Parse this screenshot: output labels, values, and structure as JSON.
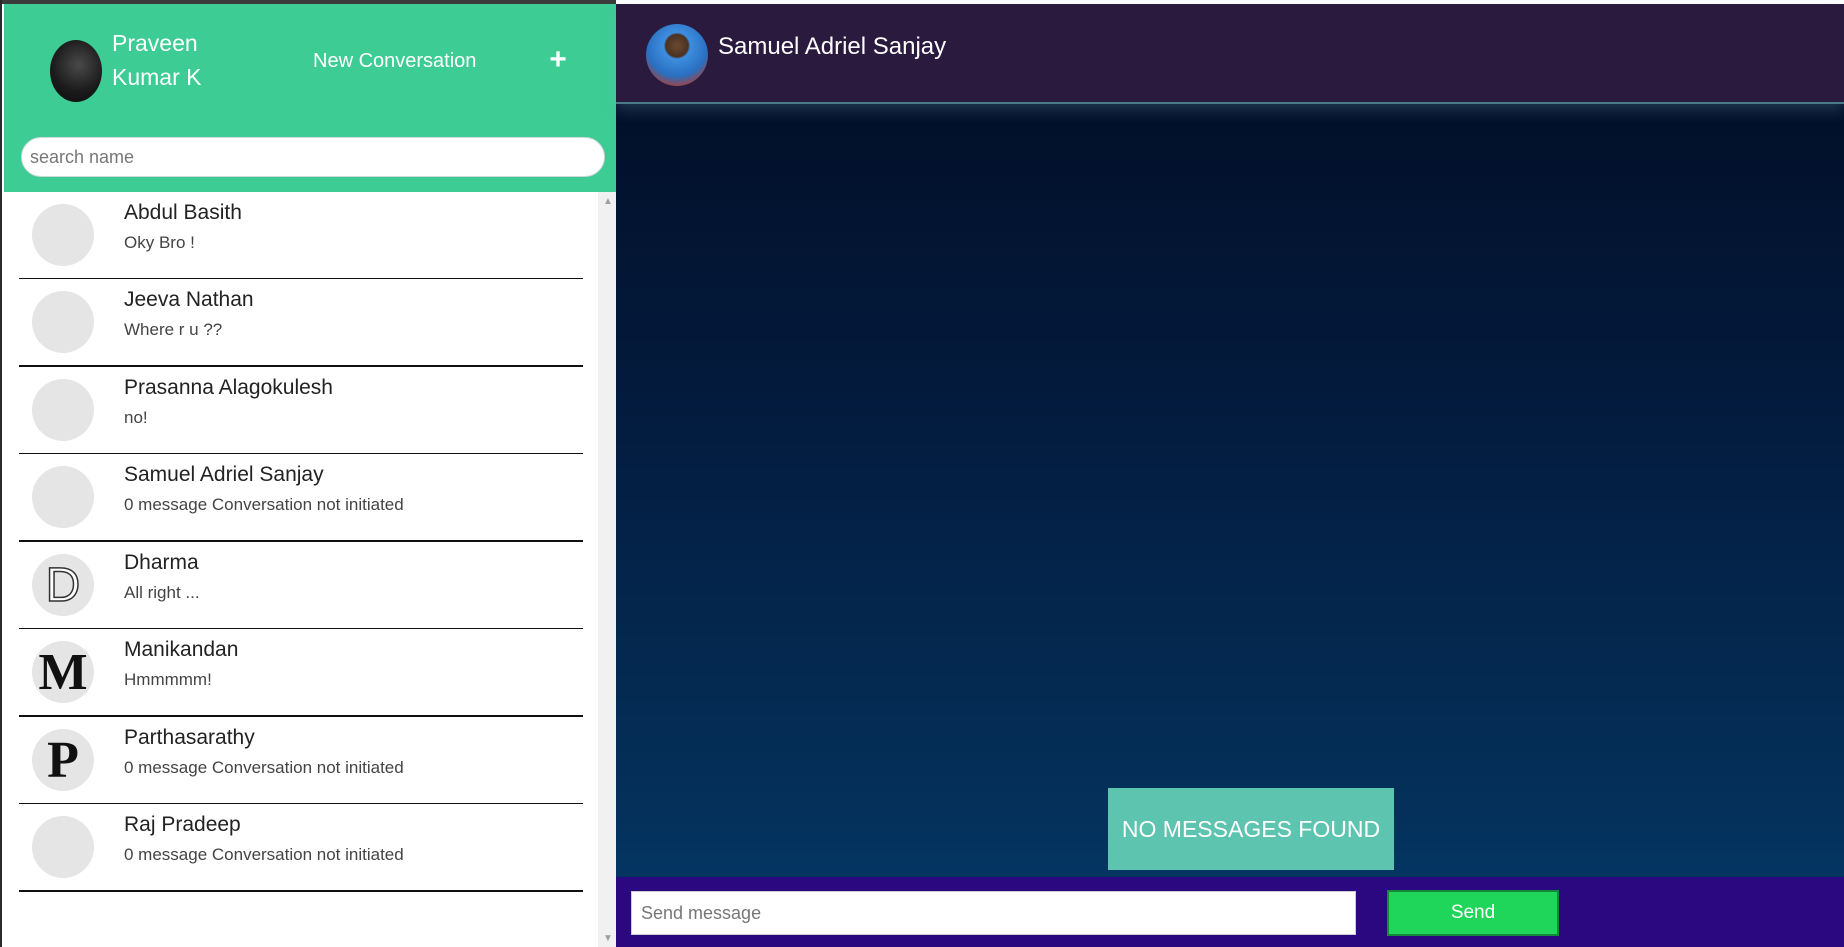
{
  "sidebar": {
    "user_name": "Praveen Kumar K",
    "new_conversation_label": "New Conversation",
    "plus_label": "+",
    "search_placeholder": "search name",
    "conversations": [
      {
        "name": "Abdul Basith",
        "last_message": "Oky Bro !"
      },
      {
        "name": "Jeeva Nathan",
        "last_message": "Where r u ??"
      },
      {
        "name": "Prasanna Alagokulesh",
        "last_message": "no!"
      },
      {
        "name": "Samuel Adriel Sanjay",
        "last_message": "0 message Conversation not initiated"
      },
      {
        "name": "Dharma",
        "last_message": "All right ..."
      },
      {
        "name": "Manikandan",
        "last_message": "Hmmmmm!"
      },
      {
        "name": "Parthasarathy",
        "last_message": "0 message Conversation not initiated"
      },
      {
        "name": "Raj Pradeep",
        "last_message": "0 message Conversation not initiated"
      }
    ],
    "avatar_letters": {
      "dharma": "D",
      "manikandan": "M",
      "parthasarathy": "P"
    }
  },
  "chat": {
    "peer_name": "Samuel Adriel Sanjay",
    "empty_state": "NO MESSAGES FOUND",
    "input_placeholder": "Send message",
    "send_label": "Send"
  },
  "colors": {
    "sidebar_header": "#3dcc94",
    "chat_header": "#2a1a3e",
    "composer": "#2c0880",
    "send_button": "#1fd65a",
    "empty_state_box": "#5dc4b0"
  }
}
